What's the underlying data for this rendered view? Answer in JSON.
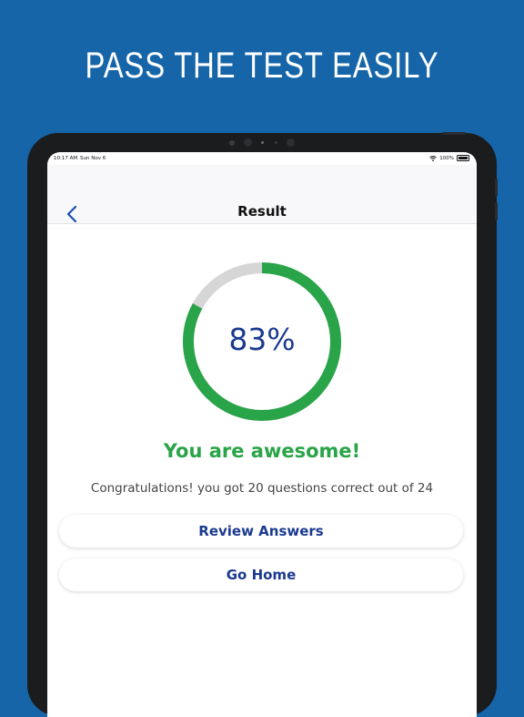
{
  "promo": {
    "headline": "PASS THE TEST EASILY"
  },
  "statusbar": {
    "time": "10:17 AM",
    "date": "Sun Nov 6",
    "battery": "100%"
  },
  "nav": {
    "title": "Result",
    "back_icon": "chevron-left-icon"
  },
  "result": {
    "percent_label": "83%",
    "progress": 0.83,
    "headline": "You are awesome!",
    "message": "Congratulations! you got 20 questions correct out of 24"
  },
  "actions": {
    "review": "Review Answers",
    "home": "Go Home"
  },
  "colors": {
    "background": "#1565a8",
    "ring_fill": "#2aa448",
    "ring_track": "#d6d6d6",
    "accent_text": "#1b3a8f"
  }
}
